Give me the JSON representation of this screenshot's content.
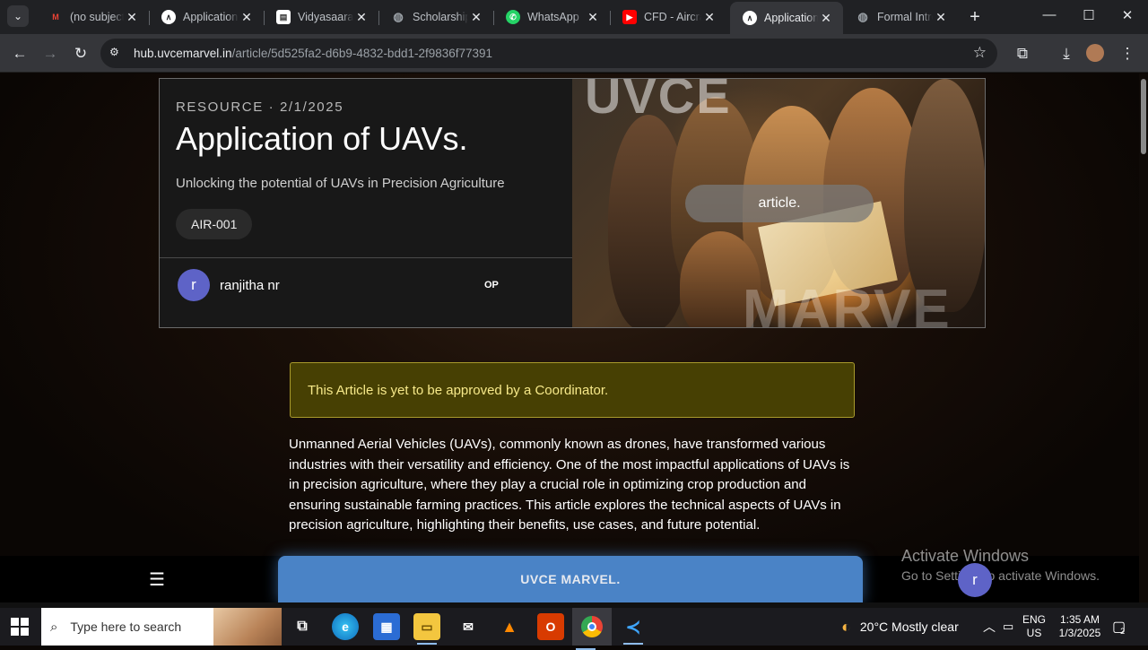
{
  "browser": {
    "tabs": [
      {
        "title": "(no subject)",
        "favicon": "gmail-icon",
        "color": "#ea4335",
        "active": false
      },
      {
        "title": "Application of UAVs.",
        "favicon": "uvce-marvel-icon",
        "color": "#ffffff",
        "active": false
      },
      {
        "title": "Vidyasaarathi",
        "favicon": "vidyasaarathi-icon",
        "color": "#ffffff",
        "active": false
      },
      {
        "title": "Scholarship",
        "favicon": "globe-icon",
        "color": "#9aa0a6",
        "active": false
      },
      {
        "title": "WhatsApp",
        "favicon": "whatsapp-icon",
        "color": "#25d366",
        "active": false
      },
      {
        "title": "CFD - Aircraft",
        "favicon": "youtube-icon",
        "color": "#ff0000",
        "active": false
      },
      {
        "title": "Application of UAVs.",
        "favicon": "uvce-marvel-icon",
        "color": "#ffffff",
        "active": true
      },
      {
        "title": "Formal Intro",
        "favicon": "globe-icon",
        "color": "#9aa0a6",
        "active": false
      }
    ],
    "url_host": "hub.uvcemarvel.in",
    "url_path": "/article/5d525fa2-d6b9-4832-bdd1-2f9836f77391"
  },
  "hero": {
    "eyebrow": "RESOURCE · 2/1/2025",
    "title": "Application of UAVs.",
    "subtitle": "Unlocking the potential of UAVs in Precision Agriculture",
    "code": "AIR-001",
    "author_initial": "r",
    "author_name": "ranjitha nr",
    "author_tag": "OP",
    "image_badge": "article.",
    "watermark_top": "UVCE",
    "watermark_bottom": "MARVE"
  },
  "notice": "This Article is yet to be approved by a Coordinator.",
  "body": "Unmanned Aerial Vehicles (UAVs), commonly known as drones, have transformed various industries with their versatility and efficiency. One of the most impactful applications of UAVs is in precision agriculture, where they play a crucial role in optimizing crop production and ensuring sustainable farming practices. This article explores the technical aspects of UAVs in precision agriculture, highlighting their benefits, use cases, and future potential.",
  "footer": {
    "brand": "UVCE MARVEL.",
    "menu_icon": "hamburger-icon",
    "user_initial": "r"
  },
  "watermark": {
    "line1": "Activate Windows",
    "line2": "Go to Settings to activate Windows."
  },
  "taskbar": {
    "search_placeholder": "Type here to search",
    "weather": "20°C  Mostly clear",
    "lang_top": "ENG",
    "lang_bottom": "US",
    "time": "1:35 AM",
    "date": "1/3/2025",
    "notifications": "2"
  },
  "colors": {
    "accent_blue": "#4a83c6",
    "avatar_purple": "#5e63c7",
    "notice_bg": "#474003",
    "notice_text": "#f7e98a"
  }
}
